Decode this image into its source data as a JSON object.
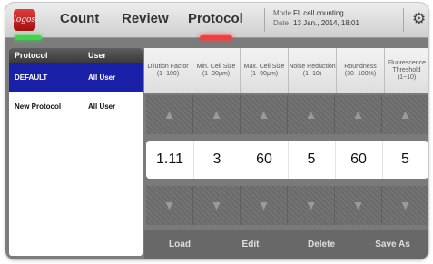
{
  "app": {
    "logo_text": "logos"
  },
  "nav": {
    "count": "Count",
    "review": "Review",
    "protocol": "Protocol"
  },
  "status": {
    "mode_label": "Mode",
    "mode_value": "FL cell counting",
    "date_label": "Date",
    "date_value": "13 Jan., 2014, 18:01"
  },
  "icons": {
    "settings": "gear-icon",
    "up": "up-arrow-icon",
    "down": "down-arrow-icon"
  },
  "colors": {
    "selected_row": "#1a21a8",
    "active_tab_glow": "#ff3a3a",
    "status_glow": "#3fd54a"
  },
  "protocol_list": {
    "columns": [
      "Protocol",
      "User"
    ],
    "rows": [
      {
        "name": "DEFAULT",
        "user": "All User",
        "selected": true
      },
      {
        "name": "New Protocol",
        "user": "All User",
        "selected": false
      }
    ]
  },
  "parameters": [
    {
      "label": "Dilution Factor",
      "range": "(1~100)",
      "value": "1.11"
    },
    {
      "label": "Min. Cell Size",
      "range": "(1~90μm)",
      "value": "3"
    },
    {
      "label": "Max. Cell Size",
      "range": "(1~90μm)",
      "value": "60"
    },
    {
      "label": "Noise Reduction",
      "range": "(1~10)",
      "value": "5"
    },
    {
      "label": "Roundness",
      "range": "(30~100%)",
      "value": "60"
    },
    {
      "label": "Fluorescence Threshold",
      "range": "(1~10)",
      "value": "5"
    }
  ],
  "actions": {
    "load": "Load",
    "edit": "Edit",
    "delete": "Delete",
    "save_as": "Save As"
  }
}
